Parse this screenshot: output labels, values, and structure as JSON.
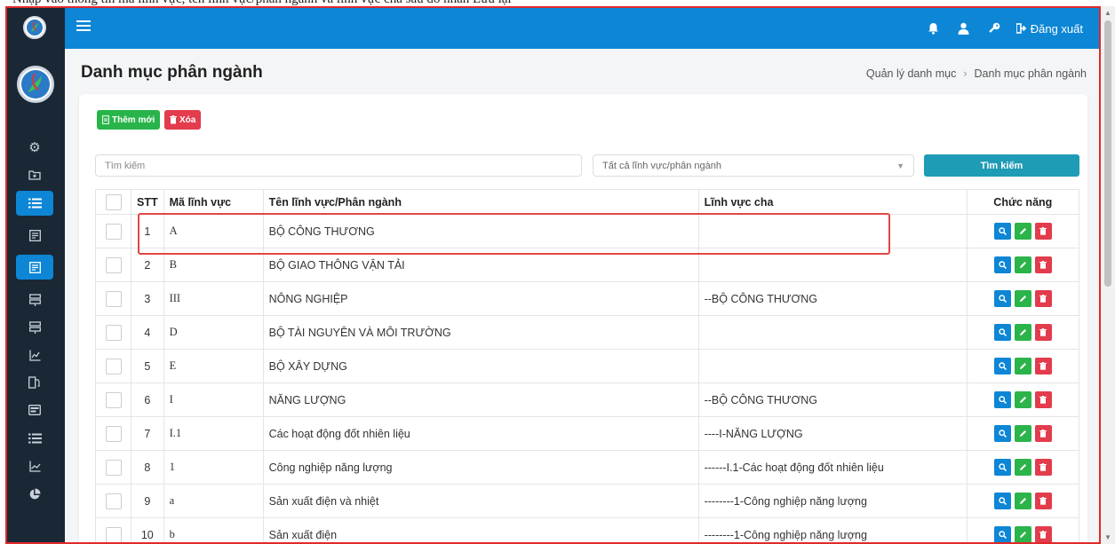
{
  "doc_top_text": "Nhập vào thông tin mã lĩnh vực, tên lĩnh vực/phân ngành và lĩnh vực cha sau đó nhấn Lưu lại",
  "topbar": {
    "menu_icon": "menu-icon",
    "bell_icon": "bell-icon",
    "user_icon": "user-icon",
    "key_icon": "key-icon",
    "logout_label": "Đăng xuất"
  },
  "sidebar": {
    "items": [
      {
        "icon": "cogs-icon",
        "active": false
      },
      {
        "icon": "folder-plus-icon",
        "active": false
      },
      {
        "icon": "list-icon",
        "active": true
      },
      {
        "icon": "document-icon",
        "active": false
      },
      {
        "icon": "document-icon",
        "active": true
      },
      {
        "icon": "server-icon",
        "active": false
      },
      {
        "icon": "server-icon",
        "active": false
      },
      {
        "icon": "chart-icon",
        "active": false
      },
      {
        "icon": "fuel-icon",
        "active": false
      },
      {
        "icon": "id-card-icon",
        "active": false
      },
      {
        "icon": "list-icon",
        "active": false
      },
      {
        "icon": "line-chart-icon",
        "active": false
      },
      {
        "icon": "pie-chart-icon",
        "active": false
      }
    ]
  },
  "page": {
    "title": "Danh mục phân ngành",
    "breadcrumb": [
      "Quản lý danh mục",
      "Danh mục phân ngành"
    ]
  },
  "toolbar": {
    "add_label": "Thêm mới",
    "delete_label": "Xóa"
  },
  "filters": {
    "search_placeholder": "Tìm kiếm",
    "select_value": "Tất cả lĩnh vực/phân ngành",
    "search_button": "Tìm kiếm"
  },
  "table": {
    "headers": [
      "STT",
      "Mã lĩnh vực",
      "Tên lĩnh vực/Phân ngành",
      "Lĩnh vực cha",
      "Chức năng"
    ],
    "rows": [
      {
        "stt": "1",
        "ma": "A",
        "ten": "BỘ CÔNG THƯƠNG",
        "cha": ""
      },
      {
        "stt": "2",
        "ma": "B",
        "ten": "BỘ GIAO THÔNG VẬN TẢI",
        "cha": ""
      },
      {
        "stt": "3",
        "ma": "III",
        "ten": "NÔNG NGHIỆP",
        "cha": "--BỘ CÔNG THƯƠNG"
      },
      {
        "stt": "4",
        "ma": "D",
        "ten": "BỘ TÀI NGUYÊN VÀ MÔI TRƯỜNG",
        "cha": ""
      },
      {
        "stt": "5",
        "ma": "E",
        "ten": "BỘ XÂY DỰNG",
        "cha": ""
      },
      {
        "stt": "6",
        "ma": "I",
        "ten": "NĂNG LƯỢNG",
        "cha": "--BỘ CÔNG THƯƠNG"
      },
      {
        "stt": "7",
        "ma": "I.1",
        "ten": "Các hoạt động đốt nhiên liệu",
        "cha": "----I-NĂNG LƯỢNG"
      },
      {
        "stt": "8",
        "ma": "1",
        "ten": "Công nghiệp năng lượng",
        "cha": "------I.1-Các hoạt động đốt nhiên liệu"
      },
      {
        "stt": "9",
        "ma": "a",
        "ten": "Sản xuất điện và nhiệt",
        "cha": "--------1-Công nghiệp năng lượng"
      },
      {
        "stt": "10",
        "ma": "b",
        "ten": "Sản xuất điện",
        "cha": "--------1-Công nghiệp năng lượng"
      }
    ]
  },
  "colors": {
    "primary": "#0d86d6",
    "sidebar_bg": "#1a2836",
    "add_green": "#28b44a",
    "delete_red": "#e23c4d",
    "search_teal": "#1e9bb5",
    "highlight_red": "#e24545"
  }
}
